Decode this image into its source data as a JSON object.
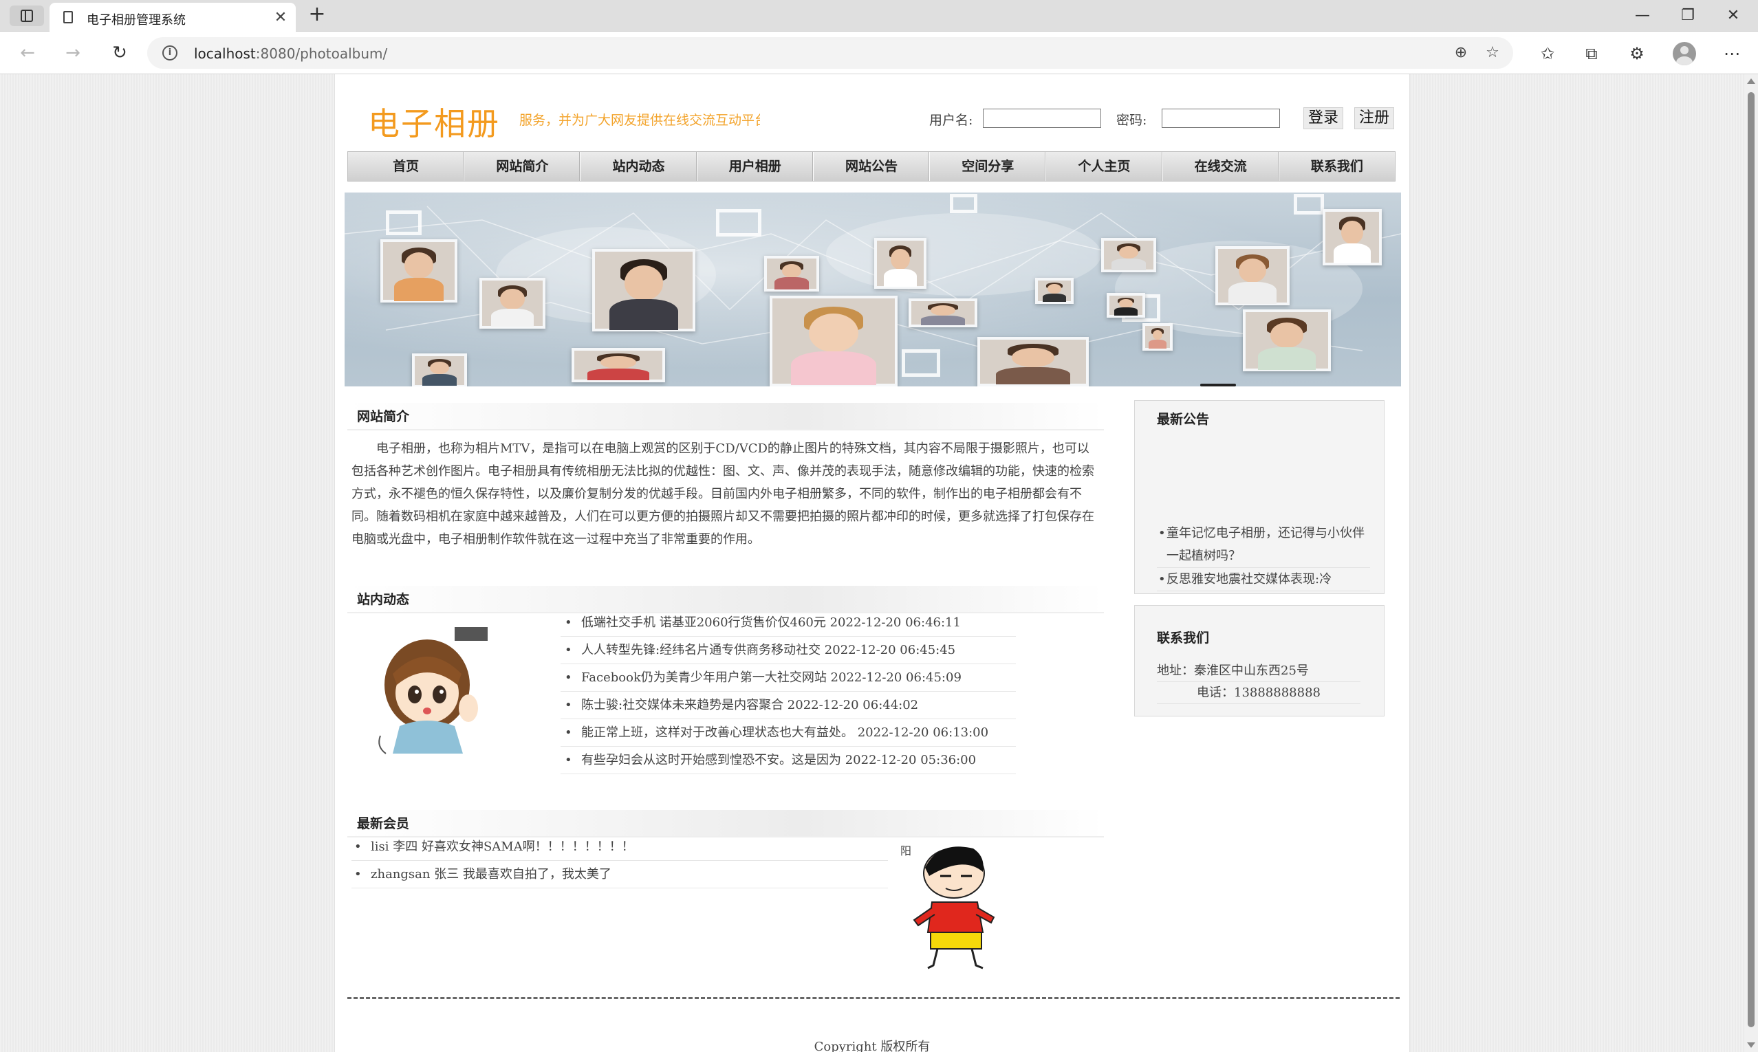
{
  "browser": {
    "tab_title": "电子相册管理系统",
    "url_host": "localhost",
    "url_rest": ":8080/photoalbum/"
  },
  "header": {
    "logo": "电子相册",
    "marquee": "服务，并为广大网友提供在线交流互动平台，本站衷心祝您生",
    "username_label": "用户名:",
    "password_label": "密码:",
    "login_button": "登录",
    "register_button": "注册"
  },
  "nav": {
    "items": [
      "首页",
      "网站简介",
      "站内动态",
      "用户相册",
      "网站公告",
      "空间分享",
      "个人主页",
      "在线交流",
      "联系我们"
    ]
  },
  "intro": {
    "title": "网站简介",
    "text": "电子相册，也称为相片MTV，是指可以在电脑上观赏的区别于CD/VCD的静止图片的特殊文档，其内容不局限于摄影照片，也可以包括各种艺术创作图片。电子相册具有传统相册无法比拟的优越性：图、文、声、像并茂的表现手法，随意修改编辑的功能，快速的检索方式，永不褪色的恒久保存特性，以及廉价复制分发的优越手段。目前国内外电子相册繁多，不同的软件，制作出的电子相册都会有不同。随着数码相机在家庭中越来越普及，人们在可以更方便的拍摄照片却又不需要把拍摄的照片都冲印的时候，更多就选择了打包保存在电脑或光盘中，电子相册制作软件就在这一过程中充当了非常重要的作用。"
  },
  "news": {
    "title": "站内动态",
    "items": [
      "低端社交手机 诺基亚2060行货售价仅460元 2022-12-20 06:46:11",
      "人人转型先锋:经纬名片通专供商务移动社交 2022-12-20 06:45:45",
      "Facebook仍为美青少年用户第一大社交网站 2022-12-20 06:45:09",
      "陈士骏:社交媒体未来趋势是内容聚合 2022-12-20 06:44:02",
      "能正常上班，这样对于改善心理状态也大有益处。 2022-12-20 06:13:00",
      "有些孕妇会从这时开始感到惶恐不安。这是因为 2022-12-20 05:36:00"
    ]
  },
  "members": {
    "title": "最新会员",
    "items": [
      "lisi 李四 好喜欢女神SAMA啊！！！！！！！！",
      "zhangsan 张三 我最喜欢自拍了，我太美了"
    ],
    "image_caption": "阳"
  },
  "sidebar": {
    "notice_title": "最新公告",
    "notices": [
      "童年记忆电子相册，还记得与小伙伴一起植树吗？",
      "反思雅安地震社交媒体表现:冷"
    ],
    "contact_title": "联系我们",
    "address": "地址：秦淮区中山东西25号",
    "phone": "电话：13888888888"
  },
  "footer": {
    "copyright": "Copyright 版权所有"
  },
  "colors": {
    "logo": "#f39a1e",
    "marquee": "#f3a32a"
  }
}
